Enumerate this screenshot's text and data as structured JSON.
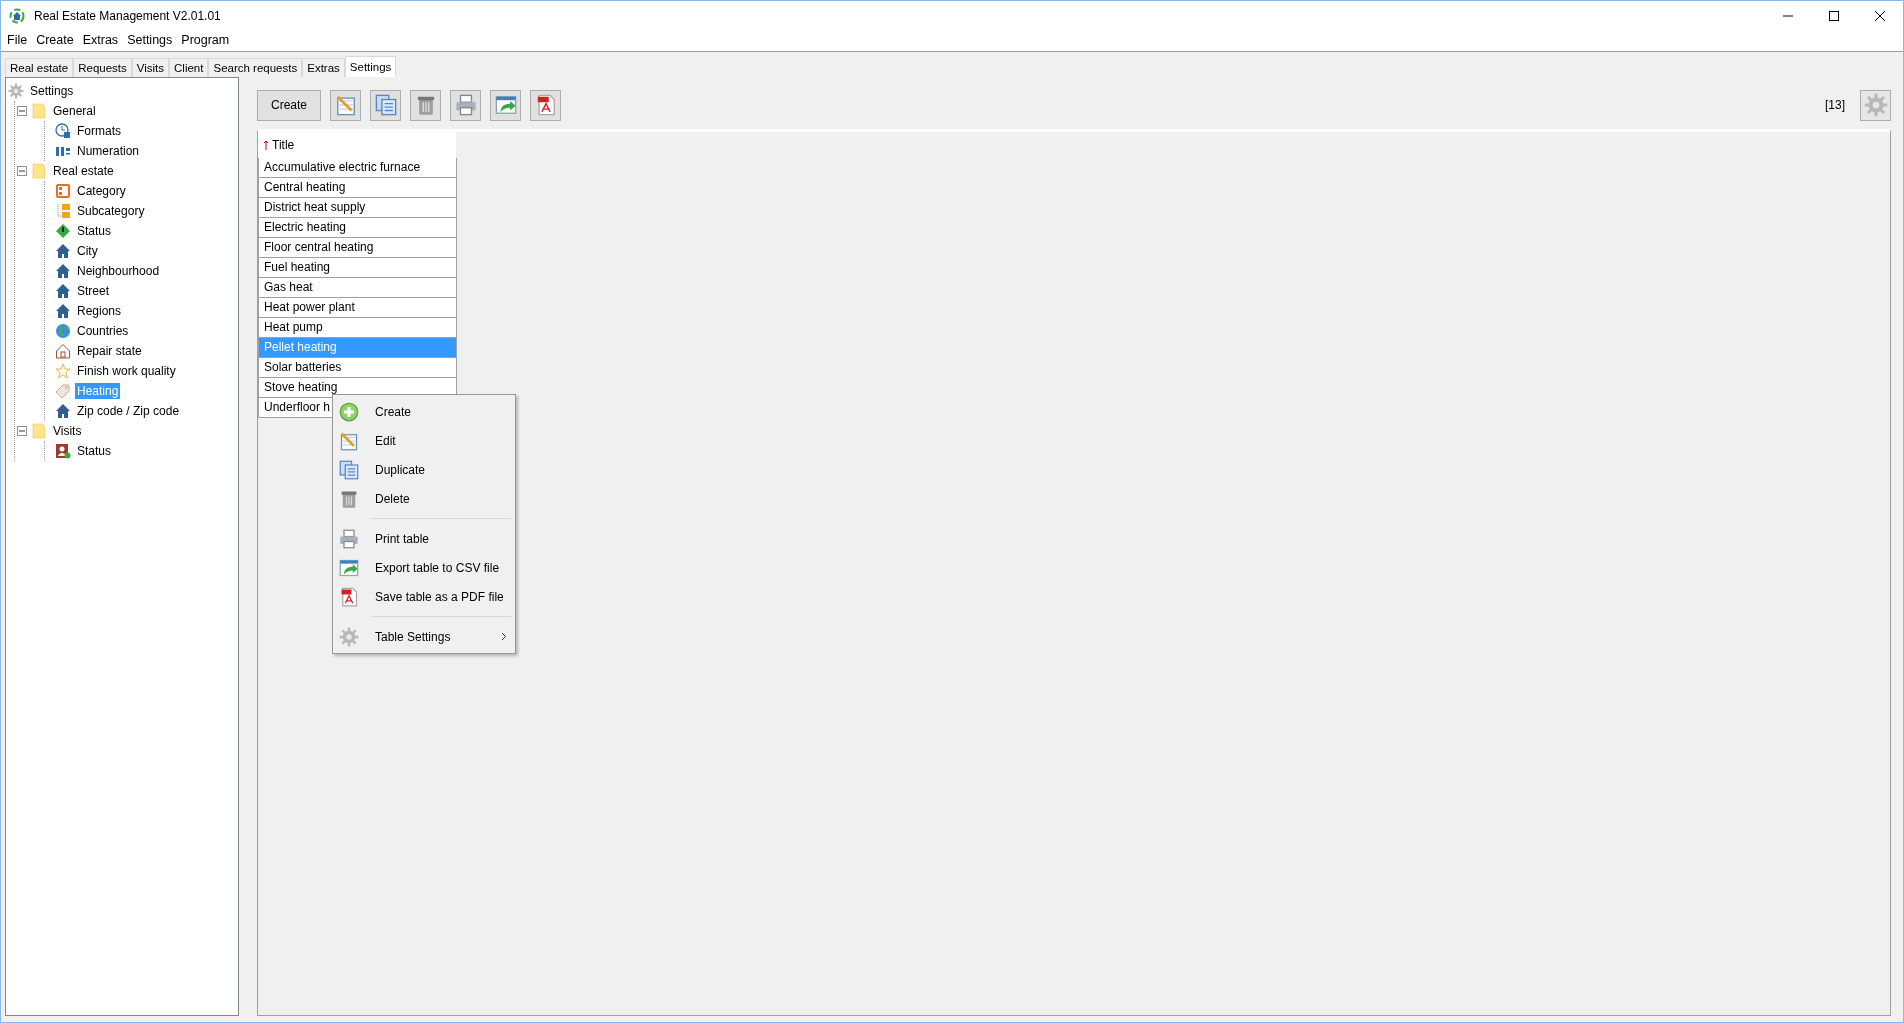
{
  "window": {
    "title": "Real Estate Management V2.01.01"
  },
  "menu_bar": [
    "File",
    "Create",
    "Extras",
    "Settings",
    "Program"
  ],
  "tabs": [
    {
      "label": "Real estate",
      "selected": false
    },
    {
      "label": "Requests",
      "selected": false
    },
    {
      "label": "Visits",
      "selected": false
    },
    {
      "label": "Client",
      "selected": false
    },
    {
      "label": "Search requests",
      "selected": false
    },
    {
      "label": "Extras",
      "selected": false
    },
    {
      "label": "Settings",
      "selected": true
    }
  ],
  "tree": [
    {
      "label": "Settings",
      "selected": false,
      "children": [
        {
          "label": "General",
          "selected": false,
          "expanded": true,
          "children": [
            {
              "label": "Formats",
              "selected": false
            },
            {
              "label": "Numeration",
              "selected": false
            }
          ]
        },
        {
          "label": "Real estate",
          "selected": false,
          "expanded": true,
          "children": [
            {
              "label": "Category",
              "selected": false
            },
            {
              "label": "Subcategory",
              "selected": false
            },
            {
              "label": "Status",
              "selected": false
            },
            {
              "label": "City",
              "selected": false
            },
            {
              "label": "Neighbourhood",
              "selected": false
            },
            {
              "label": "Street",
              "selected": false
            },
            {
              "label": "Regions",
              "selected": false
            },
            {
              "label": "Countries",
              "selected": false
            },
            {
              "label": "Repair state",
              "selected": false
            },
            {
              "label": "Finish work quality",
              "selected": false
            },
            {
              "label": "Heating",
              "selected": true
            },
            {
              "label": "Zip code / Zip code",
              "selected": false
            }
          ]
        },
        {
          "label": "Visits",
          "selected": false,
          "expanded": true,
          "children": [
            {
              "label": "Status",
              "selected": false
            }
          ]
        }
      ]
    }
  ],
  "toolbar": [
    {
      "kind": "text",
      "label": "Create"
    },
    {
      "kind": "icon"
    },
    {
      "kind": "icon"
    },
    {
      "kind": "icon"
    },
    {
      "kind": "icon"
    },
    {
      "kind": "icon"
    },
    {
      "kind": "icon"
    }
  ],
  "record_count": "[13]",
  "table": {
    "columns": [
      {
        "label": "Title",
        "sort_ascending": true
      }
    ],
    "rows": [
      {
        "title": "Accumulative electric furnace",
        "selected": false
      },
      {
        "title": "Central heating",
        "selected": false
      },
      {
        "title": "District heat supply",
        "selected": false
      },
      {
        "title": "Electric heating",
        "selected": false
      },
      {
        "title": "Floor central heating",
        "selected": false
      },
      {
        "title": "Fuel heating",
        "selected": false
      },
      {
        "title": "Gas heat",
        "selected": false
      },
      {
        "title": "Heat power plant",
        "selected": false
      },
      {
        "title": "Heat pump",
        "selected": false
      },
      {
        "title": "Pellet heating",
        "selected": true
      },
      {
        "title": "Solar batteries",
        "selected": false
      },
      {
        "title": "Stove heating",
        "selected": false
      },
      {
        "title": "Underfloor h",
        "selected": false
      }
    ]
  },
  "context_menu": [
    {
      "kind": "item",
      "label": "Create"
    },
    {
      "kind": "item",
      "label": "Edit"
    },
    {
      "kind": "item",
      "label": "Duplicate"
    },
    {
      "kind": "item",
      "label": "Delete"
    },
    {
      "kind": "separator"
    },
    {
      "kind": "item",
      "label": "Print table"
    },
    {
      "kind": "item",
      "label": "Export table to CSV file"
    },
    {
      "kind": "item",
      "label": "Save table as a PDF file"
    },
    {
      "kind": "separator"
    },
    {
      "kind": "item",
      "label": "Table Settings",
      "submenu": true
    }
  ]
}
